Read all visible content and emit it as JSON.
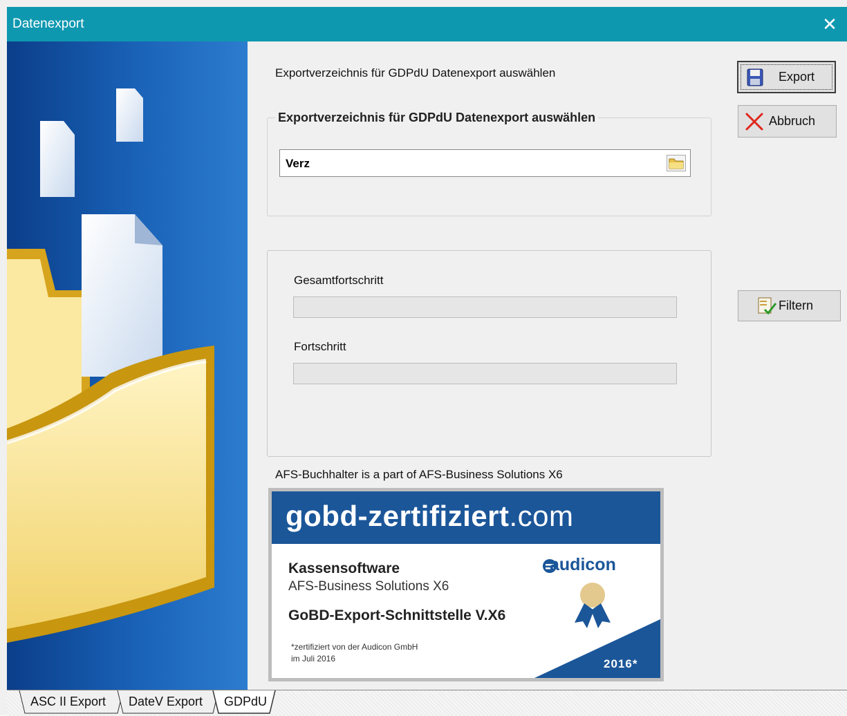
{
  "window": {
    "title": "Datenexport"
  },
  "main": {
    "heading": "Exportverzeichnis für GDPdU Datenexport auswählen",
    "group_title": "Exportverzeichnis für GDPdU Datenexport auswählen",
    "directory_value": "Verz",
    "progress": {
      "total_label": "Gesamtfortschritt",
      "total_value": 0,
      "current_label": "Fortschritt",
      "current_value": 0
    },
    "about": "AFS-Buchhalter is a part of AFS-Business Solutions X6"
  },
  "badge": {
    "domain_main": "gobd-zertifiziert",
    "domain_tld": ".com",
    "product": "Kassensoftware",
    "product_name": "AFS-Business Solutions X6",
    "interface": "GoBD-Export-Schnittstelle V.X6",
    "note_line1": "*zertifiziert von der Audicon GmbH",
    "note_line2": "im Juli 2016",
    "brand": "audicon",
    "year": "2016*"
  },
  "buttons": {
    "export": "Export",
    "abort": "Abbruch",
    "filter": "Filtern"
  },
  "tabs": [
    "ASC II Export",
    "DateV Export",
    "GDPdU"
  ],
  "active_tab": "GDPdU",
  "colors": {
    "titlebar": "#0e98b0",
    "badge_blue": "#1b5699",
    "panel_blue": "#1a63b8",
    "folder_gold": "#d7a41d"
  },
  "icons": {
    "close": "close-icon",
    "browse": "folder-icon",
    "export": "floppy-disk-icon",
    "abort": "red-x-icon",
    "filter": "checklist-icon"
  }
}
